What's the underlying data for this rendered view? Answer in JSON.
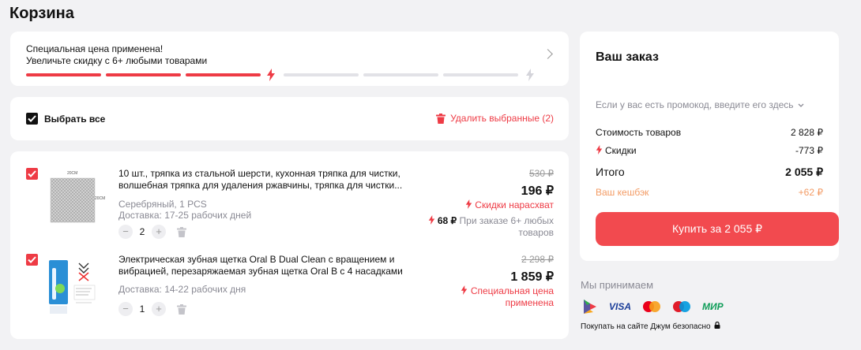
{
  "page": {
    "title": "Корзина"
  },
  "promo": {
    "line1": "Специальная цена применена!",
    "line2": "Увеличьте скидку с 6+ любыми товарами",
    "progress_filled_segments": 3,
    "progress_total_segments": 6
  },
  "select": {
    "label": "Выбрать все",
    "delete_label": "Удалить выбранные (2)"
  },
  "items": [
    {
      "title": "10 шт., тряпка из стальной шерсти, кухонная тряпка для чистки, волшебная тряпка для удаления ржавчины, тряпка для чистки...",
      "variant": "Серебряный, 1 PCS",
      "delivery": "Доставка: 17-25 рабочих дней",
      "qty": "2",
      "old_price": "530 ₽",
      "price": "196 ₽",
      "badge": "Скидки нарасхват",
      "bulk_price": "68 ₽",
      "bulk_note": "При заказе 6+ любых товаров",
      "img_label_top": "20CM",
      "img_label_side": "20CM"
    },
    {
      "title": "Электрическая зубная щетка Oral B Dual Clean с вращением и вибрацией, перезаряжаемая зубная щетка Oral B с 4 насадками",
      "delivery": "Доставка: 14-22 рабочих дня",
      "qty": "1",
      "old_price": "2 298 ₽",
      "price": "1 859 ₽",
      "badge": "Специальная цена применена"
    }
  ],
  "order": {
    "title": "Ваш заказ",
    "promo_link": "Если у вас есть промокод, введите его здесь",
    "goods_label": "Стоимость товаров",
    "goods_value": "2 828 ₽",
    "discount_label": "Скидки",
    "discount_value": "-773 ₽",
    "total_label": "Итого",
    "total_value": "2 055 ₽",
    "cashback_label": "Ваш кешбэк",
    "cashback_value": "+62 ₽",
    "buy_label": "Купить за 2 055 ₽"
  },
  "payment": {
    "title": "Мы принимаем",
    "methods": [
      "sbp-icon",
      "visa-icon",
      "mastercard-icon",
      "maestro-icon",
      "mir-icon"
    ],
    "visa_text": "VISA",
    "mir_text": "МИР",
    "safe_text": "Покупать на сайте Джум безопасно"
  },
  "colors": {
    "accent": "#ee3b45",
    "cashback": "#f39b64",
    "muted": "#8a8a94"
  }
}
